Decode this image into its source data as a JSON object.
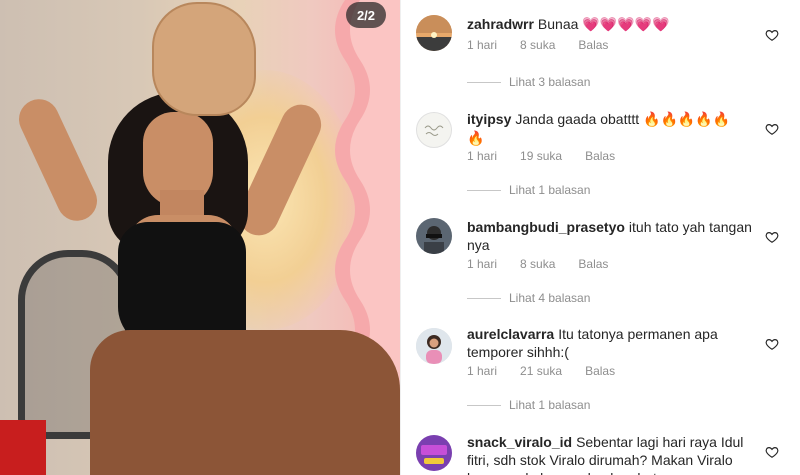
{
  "post": {
    "image_counter": "2/2"
  },
  "comments": [
    {
      "username": "zahradwrr",
      "text": "Bunaa",
      "emoji": "💗💗💗💗💗",
      "time": "1 hari",
      "likes": "8 suka",
      "reply_label": "Balas",
      "view_replies": "Lihat 3 balasan",
      "avatar": "sunset-avatar"
    },
    {
      "username": "ityipsy",
      "text": "Janda gaada obatttt",
      "emoji": "🔥🔥🔥🔥🔥",
      "emoji_wrap": "🔥",
      "time": "1 hari",
      "likes": "19 suka",
      "reply_label": "Balas",
      "view_replies": "Lihat 1 balasan",
      "avatar": "handwriting-avatar"
    },
    {
      "username": "bambangbudi_prasetyo",
      "text": "ituh tato yah tangan nya",
      "time": "1 hari",
      "likes": "8 suka",
      "reply_label": "Balas",
      "view_replies": "Lihat 4 balasan",
      "avatar": "person-avatar"
    },
    {
      "username": "aurelclavarra",
      "text": "Itu tatonya permanen apa temporer sihhh:(",
      "time": "1 hari",
      "likes": "21 suka",
      "reply_label": "Balas",
      "view_replies": "Lihat 1 balasan",
      "avatar": "woman-avatar"
    },
    {
      "username": "snack_viralo_id",
      "text": "Sebentar lagi hari raya Idul fitri, sdh stok Viralo dirumah?  Makan Viralo bersama keluarga dan kerabat",
      "avatar": "brand-avatar"
    }
  ],
  "colors": {
    "text": "#262626",
    "secondary": "#8e8e8e",
    "divider": "#efefef"
  },
  "icons": {
    "like": "heart-outline-icon"
  }
}
